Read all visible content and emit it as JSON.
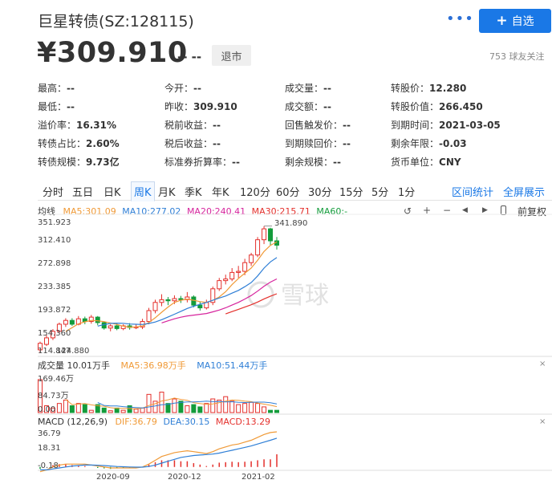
{
  "header": {
    "title": "巨星转债(SZ:128115)",
    "more": "•••",
    "add_label": "自选",
    "add_icon": "+"
  },
  "quote": {
    "price": "¥309.910",
    "change": "-- --",
    "status_badge": "退市",
    "followers": "753 球友关注"
  },
  "stats": [
    [
      {
        "k": "最高：",
        "v": "--"
      },
      {
        "k": "今开：",
        "v": "--"
      },
      {
        "k": "成交量：",
        "v": "--"
      },
      {
        "k": "转股价：",
        "v": "12.280"
      }
    ],
    [
      {
        "k": "最低：",
        "v": "--"
      },
      {
        "k": "昨收：",
        "v": "309.910"
      },
      {
        "k": "成交额：",
        "v": "--"
      },
      {
        "k": "转股价值：",
        "v": "266.450"
      }
    ],
    [
      {
        "k": "溢价率：",
        "v": "16.31%"
      },
      {
        "k": "税前收益：",
        "v": "--"
      },
      {
        "k": "回售触发价：",
        "v": "--"
      },
      {
        "k": "到期时间：",
        "v": "2021-03-05"
      }
    ],
    [
      {
        "k": "转债占比：",
        "v": "2.60%"
      },
      {
        "k": "税后收益：",
        "v": "--"
      },
      {
        "k": "到期赎回价：",
        "v": "--"
      },
      {
        "k": "剩余年限：",
        "v": "-0.03"
      }
    ],
    [
      {
        "k": "转债规模：",
        "v": "9.73亿"
      },
      {
        "k": "标准券折算率：",
        "v": "--"
      },
      {
        "k": "剩余规模：",
        "v": "--"
      },
      {
        "k": "货币单位：",
        "v": "CNY"
      }
    ]
  ],
  "tabs": [
    "分时",
    "五日",
    "日K",
    "周K",
    "月K",
    "季K",
    "年K",
    "120分",
    "60分",
    "30分",
    "15分",
    "5分",
    "1分"
  ],
  "active_tab": "周K",
  "tab_links": [
    "区间统计",
    "全屏展示"
  ],
  "ma_legend": {
    "label": "均线",
    "ma5": "MA5:301.09",
    "ma10": "MA10:277.02",
    "ma20": "MA20:240.41",
    "ma30": "MA30:215.71",
    "ma60": "MA60:-"
  },
  "toolbar": {
    "reset": "↺",
    "zoom_in": "+",
    "zoom_out": "−",
    "prev": "◀",
    "next": "▶",
    "fq": "前复权"
  },
  "price_axis": [
    "351.923",
    "312.410",
    "272.898",
    "233.385",
    "193.872",
    "154.360",
    "114.847"
  ],
  "price_marks": {
    "high": "341.890",
    "low": "124.880"
  },
  "vol_legend": {
    "vol": "成交量 10.01万手",
    "ma5": "MA5:36.98万手",
    "ma10": "MA10:51.44万手"
  },
  "vol_axis": [
    "169.46万",
    "84.73万",
    "0.00"
  ],
  "macd_legend": {
    "label": "MACD (12,26,9)",
    "dif": "DIF:36.79",
    "dea": "DEA:30.15",
    "macd": "MACD:13.29"
  },
  "macd_axis": [
    "36.79",
    "18.31",
    "-0.18"
  ],
  "date_axis": [
    "2020-09",
    "2020-12",
    "2021-02"
  ],
  "watermark": "雪球",
  "colors": {
    "up": "#e4302c",
    "down": "#139c3b",
    "ma5": "#f09a37",
    "ma10": "#2f7fd6",
    "ma20": "#d6249d",
    "ma30": "#e4302c",
    "ma60": "#139c3b",
    "accent": "#1a78e6"
  },
  "chart_data": {
    "type": "candlestick",
    "candles": [
      [
        118,
        130,
        112,
        133
      ],
      [
        128,
        140,
        125,
        145
      ],
      [
        140,
        152,
        136,
        156
      ],
      [
        152,
        165,
        148,
        168
      ],
      [
        165,
        172,
        160,
        176
      ],
      [
        172,
        165,
        162,
        176
      ],
      [
        165,
        175,
        163,
        180
      ],
      [
        175,
        170,
        165,
        179
      ],
      [
        170,
        178,
        166,
        182
      ],
      [
        178,
        168,
        163,
        180
      ],
      [
        168,
        158,
        155,
        170
      ],
      [
        158,
        162,
        152,
        165
      ],
      [
        162,
        157,
        154,
        166
      ],
      [
        157,
        162,
        154,
        165
      ],
      [
        162,
        159,
        155,
        167
      ],
      [
        159,
        160,
        156,
        165
      ],
      [
        160,
        170,
        156,
        175
      ],
      [
        170,
        190,
        165,
        195
      ],
      [
        190,
        205,
        185,
        210
      ],
      [
        205,
        210,
        198,
        220
      ],
      [
        210,
        208,
        200,
        215
      ],
      [
        208,
        212,
        202,
        218
      ],
      [
        212,
        210,
        204,
        217
      ],
      [
        210,
        215,
        205,
        224
      ],
      [
        215,
        200,
        196,
        218
      ],
      [
        200,
        195,
        190,
        206
      ],
      [
        195,
        205,
        192,
        210
      ],
      [
        205,
        230,
        200,
        234
      ],
      [
        230,
        245,
        226,
        250
      ],
      [
        245,
        248,
        238,
        256
      ],
      [
        248,
        260,
        244,
        268
      ],
      [
        260,
        262,
        250,
        272
      ],
      [
        262,
        278,
        255,
        285
      ],
      [
        278,
        292,
        272,
        296
      ],
      [
        292,
        320,
        288,
        325
      ],
      [
        320,
        340,
        312,
        345
      ],
      [
        340,
        318,
        310,
        342
      ],
      [
        318,
        310,
        302,
        325
      ]
    ],
    "volume_wan": [
      145,
      30,
      20,
      40,
      55,
      30,
      40,
      35,
      10,
      35,
      20,
      8,
      20,
      10,
      30,
      15,
      20,
      80,
      50,
      90,
      40,
      60,
      50,
      30,
      35,
      25,
      40,
      60,
      55,
      70,
      50,
      35,
      40,
      45,
      40,
      25,
      10,
      10
    ],
    "macd": {
      "dif": [
        -5,
        -3,
        0,
        2,
        3,
        3,
        3,
        3,
        2,
        1,
        0,
        -1,
        -1,
        -1,
        -1,
        -1,
        0,
        3,
        7,
        11,
        13,
        15,
        16,
        17,
        16,
        15,
        14,
        16,
        19,
        21,
        23,
        24,
        26,
        28,
        31,
        34,
        36,
        36.79
      ],
      "dea": [
        -3,
        -3,
        -2,
        -1,
        0,
        1,
        1.5,
        2,
        2,
        1.8,
        1.5,
        1,
        0.5,
        0.2,
        0,
        -0.2,
        -0.2,
        0.5,
        2,
        4,
        6,
        8,
        10,
        11,
        12,
        12.5,
        13,
        13.5,
        14.5,
        16,
        17.5,
        19,
        20.5,
        22,
        24,
        26,
        28,
        30.15
      ],
      "hist": [
        -2,
        0,
        2,
        3,
        3,
        2,
        1.5,
        1,
        0,
        -1,
        -1.5,
        -2,
        -1.5,
        -1.2,
        -1,
        -0.8,
        0.2,
        2.5,
        5,
        7,
        7,
        7,
        6,
        6,
        4,
        2.5,
        1,
        2.5,
        4.5,
        5,
        5.5,
        5,
        5.5,
        6,
        7,
        8,
        8,
        13.29
      ]
    },
    "price_range": [
      114.847,
      351.923
    ],
    "volume_range_wan": [
      0,
      169.46
    ],
    "macd_range": [
      -0.18,
      36.79
    ]
  }
}
